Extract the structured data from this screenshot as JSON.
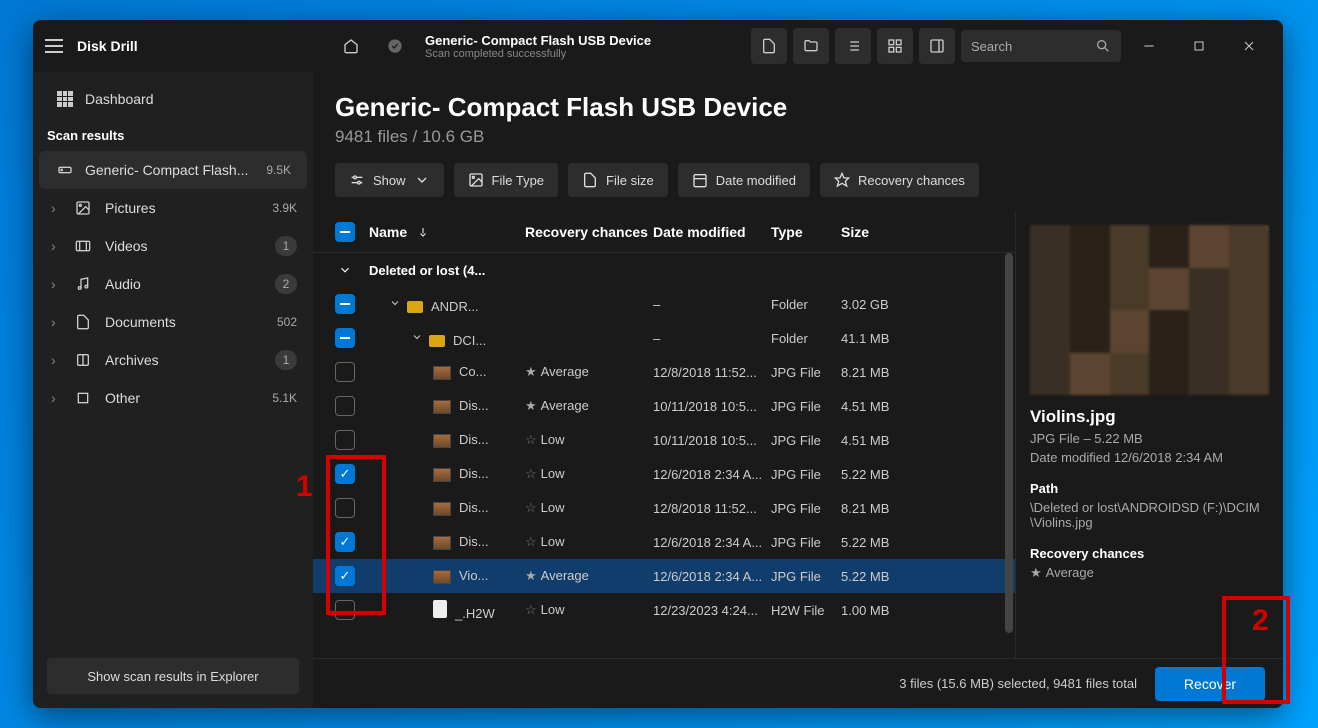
{
  "app": {
    "title": "Disk Drill"
  },
  "titlebar": {
    "device_name": "Generic- Compact Flash USB Device",
    "scan_status": "Scan completed successfully",
    "search_placeholder": "Search"
  },
  "sidebar": {
    "dashboard": "Dashboard",
    "scan_results_heading": "Scan results",
    "device": {
      "label": "Generic- Compact Flash...",
      "count": "9.5K"
    },
    "categories": [
      {
        "icon": "picture-icon",
        "label": "Pictures",
        "count": "3.9K"
      },
      {
        "icon": "video-icon",
        "label": "Videos",
        "count": "1"
      },
      {
        "icon": "audio-icon",
        "label": "Audio",
        "count": "2"
      },
      {
        "icon": "document-icon",
        "label": "Documents",
        "count": "502"
      },
      {
        "icon": "archive-icon",
        "label": "Archives",
        "count": "1"
      },
      {
        "icon": "other-icon",
        "label": "Other",
        "count": "5.1K"
      }
    ],
    "explorer_btn": "Show scan results in Explorer"
  },
  "main": {
    "title": "Generic- Compact Flash USB Device",
    "subtitle": "9481 files / 10.6 GB",
    "filters": {
      "show": "Show",
      "file_type": "File Type",
      "file_size": "File size",
      "date_modified": "Date modified",
      "recovery_chances": "Recovery chances"
    },
    "columns": {
      "name": "Name",
      "recovery": "Recovery chances",
      "date": "Date modified",
      "type": "Type",
      "size": "Size"
    },
    "group_label": "Deleted or lost (4...",
    "rows": [
      {
        "check": "partial",
        "indent": 1,
        "expand": "down",
        "icon": "folder",
        "name": "ANDR...",
        "rec": "",
        "rec_icon": "",
        "date": "–",
        "type": "Folder",
        "size": "3.02 GB"
      },
      {
        "check": "partial",
        "indent": 2,
        "expand": "down",
        "icon": "folder",
        "name": "DCI...",
        "rec": "",
        "rec_icon": "",
        "date": "–",
        "type": "Folder",
        "size": "41.1 MB"
      },
      {
        "check": "empty",
        "indent": 3,
        "icon": "thumb",
        "name": "Co...",
        "rec": "Average",
        "rec_icon": "half",
        "date": "12/8/2018 11:52...",
        "type": "JPG File",
        "size": "8.21 MB"
      },
      {
        "check": "empty",
        "indent": 3,
        "icon": "thumb",
        "name": "Dis...",
        "rec": "Average",
        "rec_icon": "half",
        "date": "10/11/2018 10:5...",
        "type": "JPG File",
        "size": "4.51 MB"
      },
      {
        "check": "empty",
        "indent": 3,
        "icon": "thumb",
        "name": "Dis...",
        "rec": "Low",
        "rec_icon": "empty",
        "date": "10/11/2018 10:5...",
        "type": "JPG File",
        "size": "4.51 MB"
      },
      {
        "check": "checked",
        "indent": 3,
        "icon": "thumb",
        "name": "Dis...",
        "rec": "Low",
        "rec_icon": "empty",
        "date": "12/6/2018 2:34 A...",
        "type": "JPG File",
        "size": "5.22 MB"
      },
      {
        "check": "empty",
        "indent": 3,
        "icon": "thumb",
        "name": "Dis...",
        "rec": "Low",
        "rec_icon": "empty",
        "date": "12/8/2018 11:52...",
        "type": "JPG File",
        "size": "8.21 MB"
      },
      {
        "check": "checked",
        "indent": 3,
        "icon": "thumb",
        "name": "Dis...",
        "rec": "Low",
        "rec_icon": "empty",
        "date": "12/6/2018 2:34 A...",
        "type": "JPG File",
        "size": "5.22 MB"
      },
      {
        "check": "checked",
        "indent": 3,
        "icon": "thumb",
        "name": "Vio...",
        "rec": "Average",
        "rec_icon": "half",
        "date": "12/6/2018 2:34 A...",
        "type": "JPG File",
        "size": "5.22 MB",
        "selected": true
      },
      {
        "check": "empty",
        "indent": 3,
        "icon": "file",
        "name": "_.H2W",
        "rec": "Low",
        "rec_icon": "empty",
        "date": "12/23/2023 4:24...",
        "type": "H2W File",
        "size": "1.00 MB"
      }
    ]
  },
  "preview": {
    "filename": "Violins.jpg",
    "meta": "JPG File – 5.22 MB",
    "modified": "Date modified 12/6/2018 2:34 AM",
    "path_label": "Path",
    "path": "\\Deleted or lost\\ANDROIDSD (F:)\\DCIM\\Violins.jpg",
    "recovery_label": "Recovery chances",
    "recovery_value": "Average"
  },
  "footer": {
    "status": "3 files (15.6 MB) selected, 9481 files total",
    "recover": "Recover"
  },
  "annotations": {
    "one": "1",
    "two": "2"
  }
}
